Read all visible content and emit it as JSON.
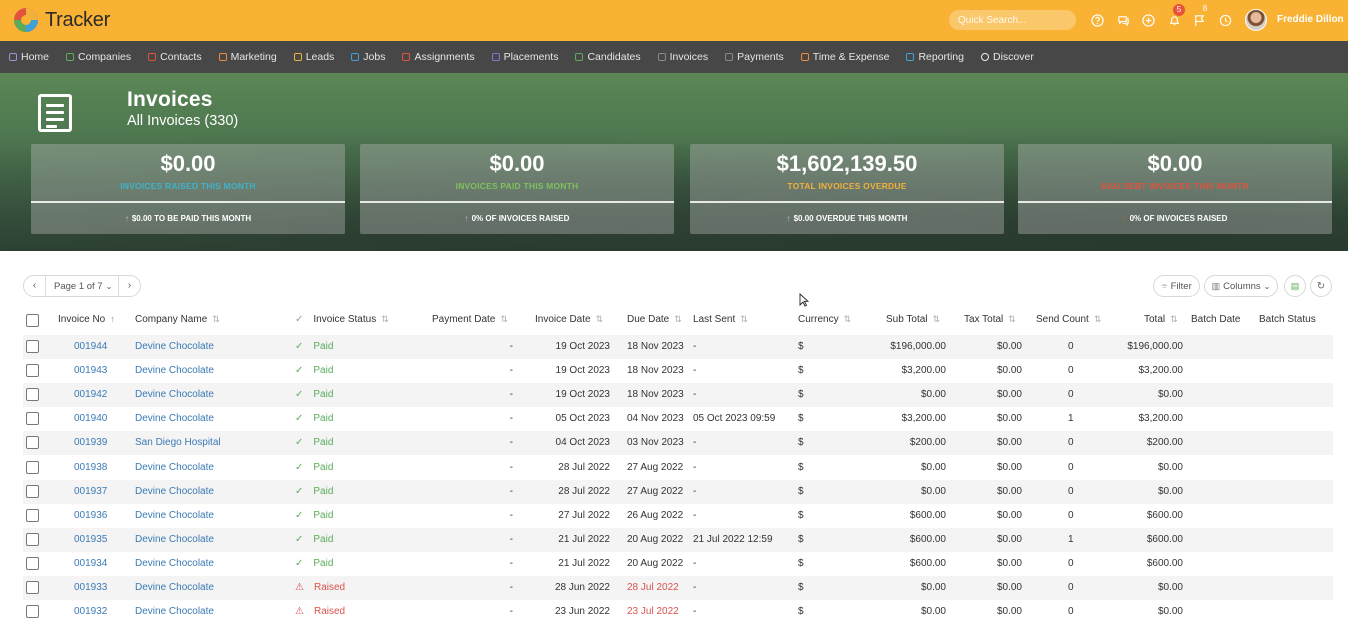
{
  "app": {
    "name": "Tracker"
  },
  "header": {
    "search_placeholder": "Quick Search...",
    "notifications_count": "5",
    "flags_count": "8",
    "user_name": "Freddie Dillon"
  },
  "nav": {
    "items": [
      {
        "label": "Home",
        "color": "#9b8fd8"
      },
      {
        "label": "Companies",
        "color": "#5aac5a"
      },
      {
        "label": "Contacts",
        "color": "#e2533c"
      },
      {
        "label": "Marketing",
        "color": "#f08a3c"
      },
      {
        "label": "Leads",
        "color": "#f0b13c"
      },
      {
        "label": "Jobs",
        "color": "#3fa0d8"
      },
      {
        "label": "Assignments",
        "color": "#e2533c"
      },
      {
        "label": "Placements",
        "color": "#8f6fd0"
      },
      {
        "label": "Candidates",
        "color": "#5aac5a"
      },
      {
        "label": "Invoices",
        "color": "#888888"
      },
      {
        "label": "Payments",
        "color": "#888888"
      },
      {
        "label": "Time & Expense",
        "color": "#f08a3c"
      },
      {
        "label": "Reporting",
        "color": "#3fa0d8"
      },
      {
        "label": "Discover",
        "color": "#dddddd"
      }
    ]
  },
  "page": {
    "title": "Invoices",
    "subtitle": "All Invoices (330)"
  },
  "stats": [
    {
      "value": "$0.00",
      "label": "INVOICES RAISED THIS MONTH",
      "label_color": "#3fb3c9",
      "foot": "$0.00 TO BE PAID THIS MONTH"
    },
    {
      "value": "$0.00",
      "label": "INVOICES PAID THIS MONTH",
      "label_color": "#7ec25d",
      "foot": "0% OF INVOICES RAISED"
    },
    {
      "value": "$1,602,139.50",
      "label": "TOTAL INVOICES OVERDUE",
      "label_color": "#f0b13c",
      "foot": "$0.00 OVERDUE THIS MONTH"
    },
    {
      "value": "$0.00",
      "label": "BAD DEBT INVOICES THIS MONTH",
      "label_color": "#e2533c",
      "foot": "0% OF INVOICES RAISED"
    }
  ],
  "pager": {
    "label": "Page 1 of 7"
  },
  "toolbar": {
    "filter_label": "Filter",
    "columns_label": "Columns"
  },
  "table": {
    "columns": [
      "Invoice No",
      "Company Name",
      "Invoice Status",
      "Payment Date",
      "Invoice Date",
      "Due Date",
      "Last Sent",
      "Currency",
      "Sub Total",
      "Tax Total",
      "Send Count",
      "Total",
      "Batch Date",
      "Batch Status"
    ],
    "rows": [
      {
        "no": "001944",
        "company": "Devine Chocolate",
        "status": "Paid",
        "payment_date": "-",
        "invoice_date": "19 Oct 2023",
        "due_date": "18 Nov 2023",
        "last_sent": "-",
        "currency": "$",
        "sub_total": "$196,000.00",
        "tax_total": "$0.00",
        "send_count": "0",
        "total": "$196,000.00",
        "batch_date": "",
        "batch_status": "",
        "overdue": false
      },
      {
        "no": "001943",
        "company": "Devine Chocolate",
        "status": "Paid",
        "payment_date": "-",
        "invoice_date": "19 Oct 2023",
        "due_date": "18 Nov 2023",
        "last_sent": "-",
        "currency": "$",
        "sub_total": "$3,200.00",
        "tax_total": "$0.00",
        "send_count": "0",
        "total": "$3,200.00",
        "batch_date": "",
        "batch_status": "",
        "overdue": false
      },
      {
        "no": "001942",
        "company": "Devine Chocolate",
        "status": "Paid",
        "payment_date": "-",
        "invoice_date": "19 Oct 2023",
        "due_date": "18 Nov 2023",
        "last_sent": "-",
        "currency": "$",
        "sub_total": "$0.00",
        "tax_total": "$0.00",
        "send_count": "0",
        "total": "$0.00",
        "batch_date": "",
        "batch_status": "",
        "overdue": false
      },
      {
        "no": "001940",
        "company": "Devine Chocolate",
        "status": "Paid",
        "payment_date": "-",
        "invoice_date": "05 Oct 2023",
        "due_date": "04 Nov 2023",
        "last_sent": "05 Oct 2023 09:59",
        "currency": "$",
        "sub_total": "$3,200.00",
        "tax_total": "$0.00",
        "send_count": "1",
        "total": "$3,200.00",
        "batch_date": "",
        "batch_status": "",
        "overdue": false
      },
      {
        "no": "001939",
        "company": "San Diego Hospital",
        "status": "Paid",
        "payment_date": "-",
        "invoice_date": "04 Oct 2023",
        "due_date": "03 Nov 2023",
        "last_sent": "-",
        "currency": "$",
        "sub_total": "$200.00",
        "tax_total": "$0.00",
        "send_count": "0",
        "total": "$200.00",
        "batch_date": "",
        "batch_status": "",
        "overdue": false
      },
      {
        "no": "001938",
        "company": "Devine Chocolate",
        "status": "Paid",
        "payment_date": "-",
        "invoice_date": "28 Jul 2022",
        "due_date": "27 Aug 2022",
        "last_sent": "-",
        "currency": "$",
        "sub_total": "$0.00",
        "tax_total": "$0.00",
        "send_count": "0",
        "total": "$0.00",
        "batch_date": "",
        "batch_status": "",
        "overdue": false
      },
      {
        "no": "001937",
        "company": "Devine Chocolate",
        "status": "Paid",
        "payment_date": "-",
        "invoice_date": "28 Jul 2022",
        "due_date": "27 Aug 2022",
        "last_sent": "-",
        "currency": "$",
        "sub_total": "$0.00",
        "tax_total": "$0.00",
        "send_count": "0",
        "total": "$0.00",
        "batch_date": "",
        "batch_status": "",
        "overdue": false
      },
      {
        "no": "001936",
        "company": "Devine Chocolate",
        "status": "Paid",
        "payment_date": "-",
        "invoice_date": "27 Jul 2022",
        "due_date": "26 Aug 2022",
        "last_sent": "-",
        "currency": "$",
        "sub_total": "$600.00",
        "tax_total": "$0.00",
        "send_count": "0",
        "total": "$600.00",
        "batch_date": "",
        "batch_status": "",
        "overdue": false
      },
      {
        "no": "001935",
        "company": "Devine Chocolate",
        "status": "Paid",
        "payment_date": "-",
        "invoice_date": "21 Jul 2022",
        "due_date": "20 Aug 2022",
        "last_sent": "21 Jul 2022 12:59",
        "currency": "$",
        "sub_total": "$600.00",
        "tax_total": "$0.00",
        "send_count": "1",
        "total": "$600.00",
        "batch_date": "",
        "batch_status": "",
        "overdue": false
      },
      {
        "no": "001934",
        "company": "Devine Chocolate",
        "status": "Paid",
        "payment_date": "-",
        "invoice_date": "21 Jul 2022",
        "due_date": "20 Aug 2022",
        "last_sent": "-",
        "currency": "$",
        "sub_total": "$600.00",
        "tax_total": "$0.00",
        "send_count": "0",
        "total": "$600.00",
        "batch_date": "",
        "batch_status": "",
        "overdue": false
      },
      {
        "no": "001933",
        "company": "Devine Chocolate",
        "status": "Raised",
        "payment_date": "-",
        "invoice_date": "28 Jun 2022",
        "due_date": "28 Jul 2022",
        "last_sent": "-",
        "currency": "$",
        "sub_total": "$0.00",
        "tax_total": "$0.00",
        "send_count": "0",
        "total": "$0.00",
        "batch_date": "",
        "batch_status": "",
        "overdue": true
      },
      {
        "no": "001932",
        "company": "Devine Chocolate",
        "status": "Raised",
        "payment_date": "-",
        "invoice_date": "23 Jun 2022",
        "due_date": "23 Jul 2022",
        "last_sent": "-",
        "currency": "$",
        "sub_total": "$0.00",
        "tax_total": "$0.00",
        "send_count": "0",
        "total": "$0.00",
        "batch_date": "",
        "batch_status": "",
        "overdue": true
      }
    ]
  }
}
